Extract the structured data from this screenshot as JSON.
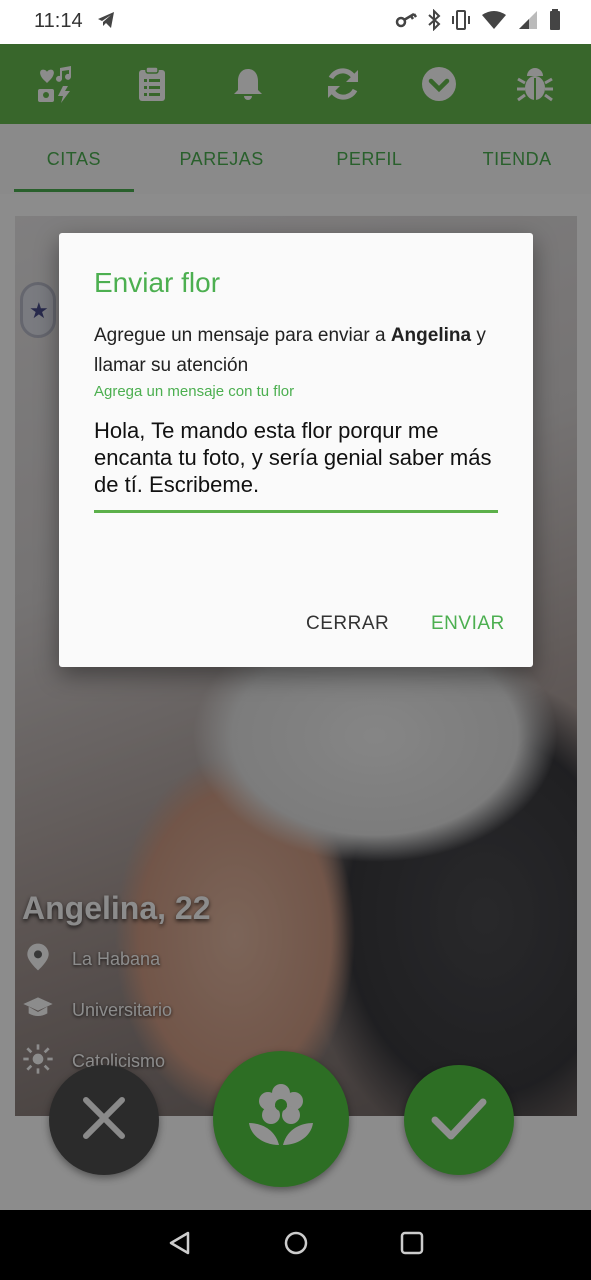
{
  "status_bar": {
    "time": "11:14"
  },
  "app_bar": {
    "icons": [
      "dating-icon",
      "clipboard-list-icon",
      "bell-icon",
      "refresh-icon",
      "chevron-down-circle-icon",
      "bug-icon"
    ],
    "background": "#66bb4f"
  },
  "tabs": [
    {
      "label": "CITAS",
      "active": true
    },
    {
      "label": "PAREJAS",
      "active": false
    },
    {
      "label": "PERFIL",
      "active": false
    },
    {
      "label": "TIENDA",
      "active": false
    }
  ],
  "profile": {
    "name_age": "Angelina, 22",
    "location": "La Habana",
    "education": "Universitario",
    "religion": "Catolicismo"
  },
  "dialog": {
    "title": "Enviar flor",
    "message_prefix": "Agregue un mensaje para enviar a ",
    "recipient": "Angelina",
    "message_suffix": " y llamar su atención",
    "field_label": "Agrega un mensaje con tu flor",
    "field_value": "Hola, Te mando esta flor porqur me encanta tu foto, y sería genial saber más de tí. Escribeme.",
    "close_label": "CERRAR",
    "send_label": "ENVIAR"
  },
  "colors": {
    "accent": "#4caf50",
    "dark_green": "#2d6e24"
  }
}
